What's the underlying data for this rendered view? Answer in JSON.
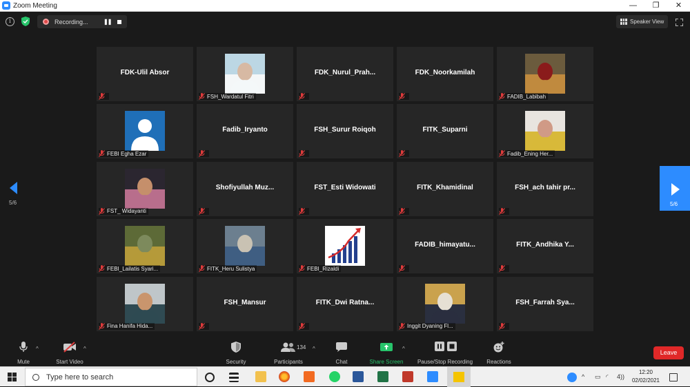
{
  "window": {
    "title": "Zoom Meeting",
    "controls": [
      "—",
      "❐",
      "✕"
    ]
  },
  "topbar": {
    "recording_label": "Recording...",
    "pause_glyph": "❚❚",
    "speaker_view_label": "Speaker View"
  },
  "gallery": {
    "page_indicator": "5/6",
    "tiles": [
      {
        "name": "FDK-Ulil Absor",
        "display": "name"
      },
      {
        "name": "FSH_Wardatul Fitri",
        "display": "photo",
        "photo_colors": [
          "#bcd7e4",
          "#f4f7f8",
          "#d7b9a3"
        ]
      },
      {
        "name": "FDK_Nurul_Prah...",
        "display": "name"
      },
      {
        "name": "FDK_Noorkamilah",
        "display": "name"
      },
      {
        "name": "FADIB_Labibah",
        "display": "photo",
        "photo_colors": [
          "#6b5b3d",
          "#c08a3e",
          "#8a1b1b"
        ]
      },
      {
        "name": "FEBI Egha Ezar",
        "display": "avatar"
      },
      {
        "name": "Fadib_Iryanto",
        "display": "name"
      },
      {
        "name": "FSH_Surur Roiqoh",
        "display": "name"
      },
      {
        "name": "FITK_Suparni",
        "display": "name"
      },
      {
        "name": "Fadib_Ening Her...",
        "display": "photo",
        "photo_colors": [
          "#e8e4df",
          "#d8b93a",
          "#d09a86"
        ]
      },
      {
        "name": "FST_ Widayanti",
        "display": "photo",
        "photo_colors": [
          "#2b2630",
          "#b86e8c",
          "#c58f6b"
        ]
      },
      {
        "name": "Shofiyullah Muz...",
        "display": "name"
      },
      {
        "name": "FST_Esti Widowati",
        "display": "name"
      },
      {
        "name": "FITK_Khamidinal",
        "display": "name"
      },
      {
        "name": "FSH_ach tahir pr...",
        "display": "name"
      },
      {
        "name": "FEBI_Lailatis Syari...",
        "display": "photo",
        "photo_colors": [
          "#5d6a37",
          "#b59a3a",
          "#7d8a5c"
        ]
      },
      {
        "name": "FITK_Heru Sulistya",
        "display": "photo",
        "photo_colors": [
          "#6c7f8f",
          "#3f5e82",
          "#c9c2b3"
        ]
      },
      {
        "name": "FEBI_Rizaldi",
        "display": "chart-photo"
      },
      {
        "name": "FADIB_himayatu...",
        "display": "name"
      },
      {
        "name": "FITK_Andhika Y...",
        "display": "name"
      },
      {
        "name": "Fina Hanifa Hida...",
        "display": "photo",
        "photo_colors": [
          "#bfc6c9",
          "#2f4a52",
          "#c9956d"
        ]
      },
      {
        "name": "FSH_Mansur",
        "display": "name"
      },
      {
        "name": "FITK_Dwi Ratna...",
        "display": "name"
      },
      {
        "name": "Inggit Dyaning Fl...",
        "display": "photo",
        "photo_colors": [
          "#caa24d",
          "#2a2f3f",
          "#e6e0d4"
        ]
      },
      {
        "name": "FSH_Farrah Sya...",
        "display": "name"
      }
    ]
  },
  "toolbar": {
    "mute": "Mute",
    "start_video": "Start Video",
    "security": "Security",
    "participants": "Participants",
    "participants_count": "134",
    "chat": "Chat",
    "share_screen": "Share Screen",
    "pause_stop_recording": "Pause/Stop Recording",
    "reactions": "Reactions",
    "leave": "Leave"
  },
  "taskbar": {
    "search_placeholder": "Type here to search",
    "time": "12:20",
    "date": "02/02/2021",
    "lang": "4))"
  },
  "colors": {
    "accent": "#2d8cff",
    "leave": "#e02828",
    "share_green": "#27c46b",
    "mic_off_red": "#e03c3c"
  }
}
